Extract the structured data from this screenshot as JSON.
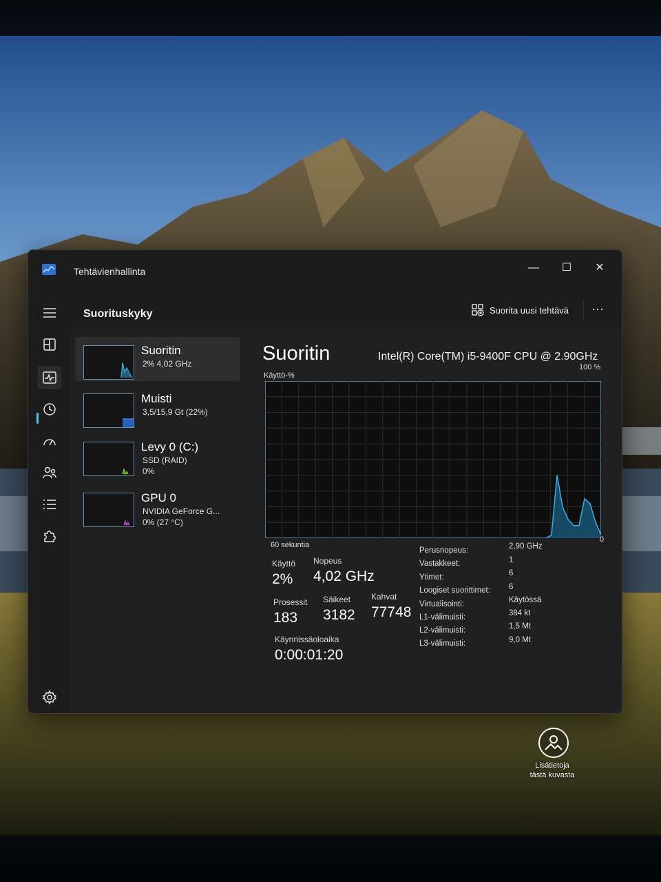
{
  "window": {
    "title": "Tehtävienhallinta"
  },
  "header": {
    "title": "Suorituskyky",
    "run_task_label": "Suorita uusi tehtävä",
    "more_label": "···"
  },
  "nav": {
    "active": "performance",
    "items": [
      "menu-icon",
      "processes-icon",
      "performance-icon",
      "app-history-icon",
      "startup-icon",
      "users-icon",
      "details-icon",
      "services-icon"
    ],
    "settings": "gear-icon"
  },
  "resources": [
    {
      "name": "Suoritin",
      "line1": "2% 4,02 GHz",
      "line2": "",
      "selected": true
    },
    {
      "name": "Muisti",
      "line1": "3,5/15,9 Gt (22%)",
      "line2": "",
      "selected": false
    },
    {
      "name": "Levy 0 (C:)",
      "line1": "SSD (RAID)",
      "line2": "0%",
      "selected": false
    },
    {
      "name": "GPU 0",
      "line1": "NVIDIA GeForce G...",
      "line2": "0% (27 °C)",
      "selected": false
    }
  ],
  "detail": {
    "heading": "Suoritin",
    "model": "Intel(R) Core(TM) i5-9400F CPU @ 2.90GHz",
    "usage_axis_label": "Käyttö-%",
    "usage_max_label": "100 %",
    "time_label": "60 sekuntia",
    "zero_label": "0",
    "stats": {
      "usage_label": "Käyttö",
      "usage_value": "2%",
      "speed_label": "Nopeus",
      "speed_value": "4,02 GHz",
      "processes_label": "Prosessit",
      "processes_value": "183",
      "threads_label": "Säikeet",
      "threads_value": "3182",
      "handles_label": "Kahvat",
      "handles_value": "77748",
      "uptime_label": "Käynnissäoloaika",
      "uptime_value": "0:00:01:20"
    },
    "specs": [
      {
        "label": "Perusnopeus:",
        "value": "2,90 GHz"
      },
      {
        "label": "Vastakkeet:",
        "value": "1"
      },
      {
        "label": "Ytimet:",
        "value": "6"
      },
      {
        "label": "Loogiset suorittimet:",
        "value": "6"
      },
      {
        "label": "Virtualisointi:",
        "value": "Käytössä"
      },
      {
        "label": "L1-välimuisti:",
        "value": "384 kt"
      },
      {
        "label": "L2-välimuisti:",
        "value": "1,5 Mt"
      },
      {
        "label": "L3-välimuisti:",
        "value": "9,0 Mt"
      }
    ],
    "usage_history_percent": [
      0,
      0,
      0,
      0,
      0,
      0,
      0,
      0,
      0,
      0,
      0,
      0,
      0,
      0,
      0,
      0,
      0,
      0,
      0,
      0,
      0,
      0,
      0,
      0,
      0,
      0,
      0,
      0,
      0,
      0,
      0,
      0,
      0,
      0,
      0,
      0,
      0,
      0,
      0,
      0,
      0,
      0,
      0,
      0,
      0,
      0,
      0,
      0,
      0,
      0,
      0,
      0,
      2,
      40,
      20,
      12,
      8,
      8,
      25,
      22,
      10,
      2
    ]
  },
  "desktop": {
    "info_line1": "Lisätietoja",
    "info_line2": "tästä kuvasta"
  },
  "colors": {
    "accent": "#4cc2ff",
    "graph_line": "#3aa8d8",
    "graph_fill": "#17506e"
  }
}
